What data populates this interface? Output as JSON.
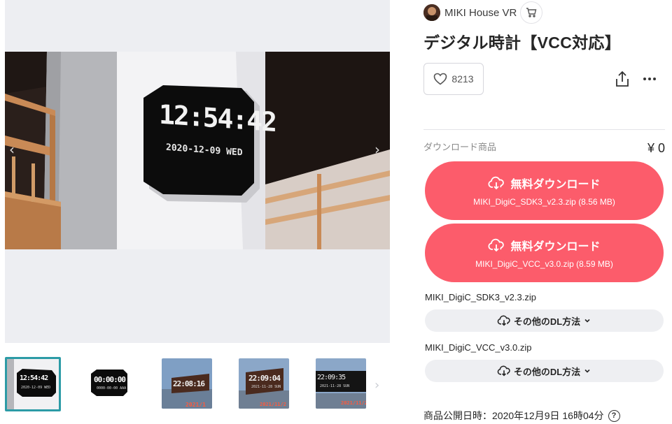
{
  "product": {
    "shop_name": "MIKI House VR",
    "title": "デジタル時計【VCC対応】",
    "likes": "8213",
    "download_label": "ダウンロード商品",
    "price": "¥ 0",
    "published": "商品公開日時：2020年12月9日 16時04分"
  },
  "gallery": {
    "clock_time": "12:54:42",
    "clock_date": "2020-12-09",
    "clock_day": "WED",
    "thumbs": [
      {
        "big": "12:54:42",
        "small": "2020-12-09 WED",
        "label": ""
      },
      {
        "big": "00:00:00",
        "small": "0000-00-00 AAA",
        "label": ""
      },
      {
        "big": "22:08:16",
        "small": "",
        "label": "2021/1"
      },
      {
        "big": "22:09:04",
        "small": "2021-11-28 SUN",
        "label": "2021/11/2"
      },
      {
        "big": "22:09:35",
        "small": "2021-11-28 SUN",
        "label": "2021/11/2"
      }
    ]
  },
  "downloads": [
    {
      "button_label": "無料ダウンロード",
      "file_size": "MIKI_DigiC_SDK3_v2.3.zip (8.56 MB)"
    },
    {
      "button_label": "無料ダウンロード",
      "file_size": "MIKI_DigiC_VCC_v3.0.zip (8.59 MB)"
    }
  ],
  "other_methods": [
    {
      "file": "MIKI_DigiC_SDK3_v2.3.zip",
      "label": "その他のDL方法"
    },
    {
      "file": "MIKI_DigiC_VCC_v3.0.zip",
      "label": "その他のDL方法"
    }
  ],
  "colors": {
    "accent": "#fc5c6b",
    "thumb_border": "#2c9ba6"
  },
  "icons": [
    "cart-icon",
    "heart-icon",
    "share-icon",
    "more-icon",
    "cloud-download-icon",
    "chevron-down-icon",
    "help-icon",
    "chevron-left-icon",
    "chevron-right-icon"
  ]
}
